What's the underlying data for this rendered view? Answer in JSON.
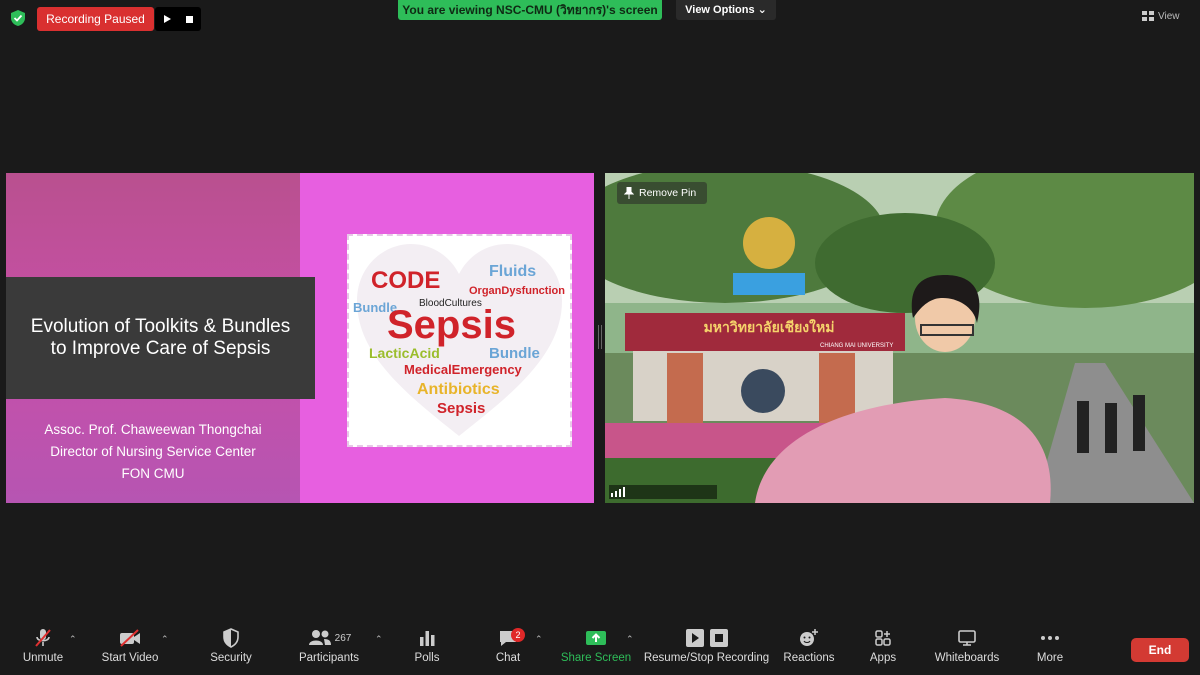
{
  "top": {
    "recording_status": "Recording Paused",
    "viewing_banner": "You are viewing NSC-CMU (วิทยากร)'s screen",
    "view_options": "View Options ⌄",
    "view_label": "View"
  },
  "slide": {
    "title_line1": "Evolution of Toolkits & Bundles",
    "title_line2": "to Improve Care of Sepsis",
    "author_line1": "Assoc. Prof. Chaweewan Thongchai",
    "author_line2": "Director of Nursing Service Center",
    "author_line3": "FON CMU",
    "word_cloud": {
      "sepsis_main": "Sepsis",
      "code": "CODE",
      "fluids": "Fluids",
      "organ": "OrganDysfunction",
      "blood": "BloodCultures",
      "lactic": "LacticAcid",
      "bundle": "Bundle",
      "medical": "MedicalEmergency",
      "antibiotics": "Antibiotics",
      "sepsis_small": "Sepsis"
    }
  },
  "video": {
    "remove_pin": "Remove Pin",
    "sign_top": "มหาวิทยาลัยเชียงใหม่",
    "sign_sub": "CHIANG MAI UNIVERSITY"
  },
  "toolbar": {
    "unmute": "Unmute",
    "start_video": "Start Video",
    "security": "Security",
    "participants": "Participants",
    "participants_count": "267",
    "polls": "Polls",
    "chat": "Chat",
    "chat_badge": "2",
    "share_screen": "Share Screen",
    "recording": "Resume/Stop Recording",
    "reactions": "Reactions",
    "apps": "Apps",
    "whiteboards": "Whiteboards",
    "more": "More",
    "end": "End"
  },
  "colors": {
    "slide_bg": "#e75fe0",
    "rec_red": "#d93030",
    "banner_green": "#2ebd59",
    "end_red": "#d33a33"
  }
}
